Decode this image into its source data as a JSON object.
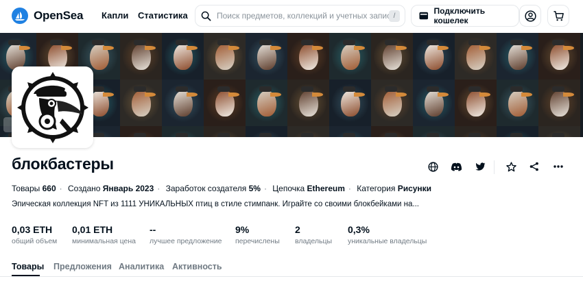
{
  "header": {
    "logo_text": "OpenSea",
    "nav": [
      "Капли",
      "Статистика"
    ],
    "search_placeholder": "Поиск предметов, коллекций и учетных запис...",
    "search_shortcut": "/",
    "wallet_label": "Подключить кошелек"
  },
  "collection": {
    "name": "блокбастеры",
    "meta": {
      "items_label": "Товары",
      "items_value": "660",
      "created_label": "Создано",
      "created_value": "Январь 2023",
      "earnings_label": "Заработок создателя",
      "earnings_value": "5%",
      "chain_label": "Цепочка",
      "chain_value": "Ethereum",
      "category_label": "Категория",
      "category_value": "Рисунки"
    },
    "description": "Эпическая коллекция NFT из 1111 УНИКАЛЬНЫХ птиц в стиле стимпанк. Играйте со своими блокбейками на...",
    "stats": [
      {
        "value": "0,03 ETH",
        "label": "общий объем"
      },
      {
        "value": "0,01 ETH",
        "label": "минимальная цена"
      },
      {
        "value": "--",
        "label": "лучшее предложение"
      },
      {
        "value": "9%",
        "label": "перечислены"
      },
      {
        "value": "2",
        "label": "владельцы"
      },
      {
        "value": "0,3%",
        "label": "уникальные владельцы"
      }
    ]
  },
  "tabs": [
    "Товары",
    "Предложения",
    "Аналитика",
    "Активность"
  ],
  "active_tab": "Товары",
  "colors": {
    "brand": "#2081e2",
    "text": "#04111d",
    "muted": "#707a83",
    "border": "#e5e8eb",
    "banner_bg": "#161c22"
  },
  "icons": {
    "search": "search-icon",
    "wallet": "wallet-icon",
    "profile": "user-circle-icon",
    "cart": "cart-icon",
    "website": "globe-icon",
    "discord": "discord-icon",
    "twitter": "twitter-icon",
    "watchlist": "star-icon",
    "share": "share-icon",
    "more": "more-icon"
  }
}
